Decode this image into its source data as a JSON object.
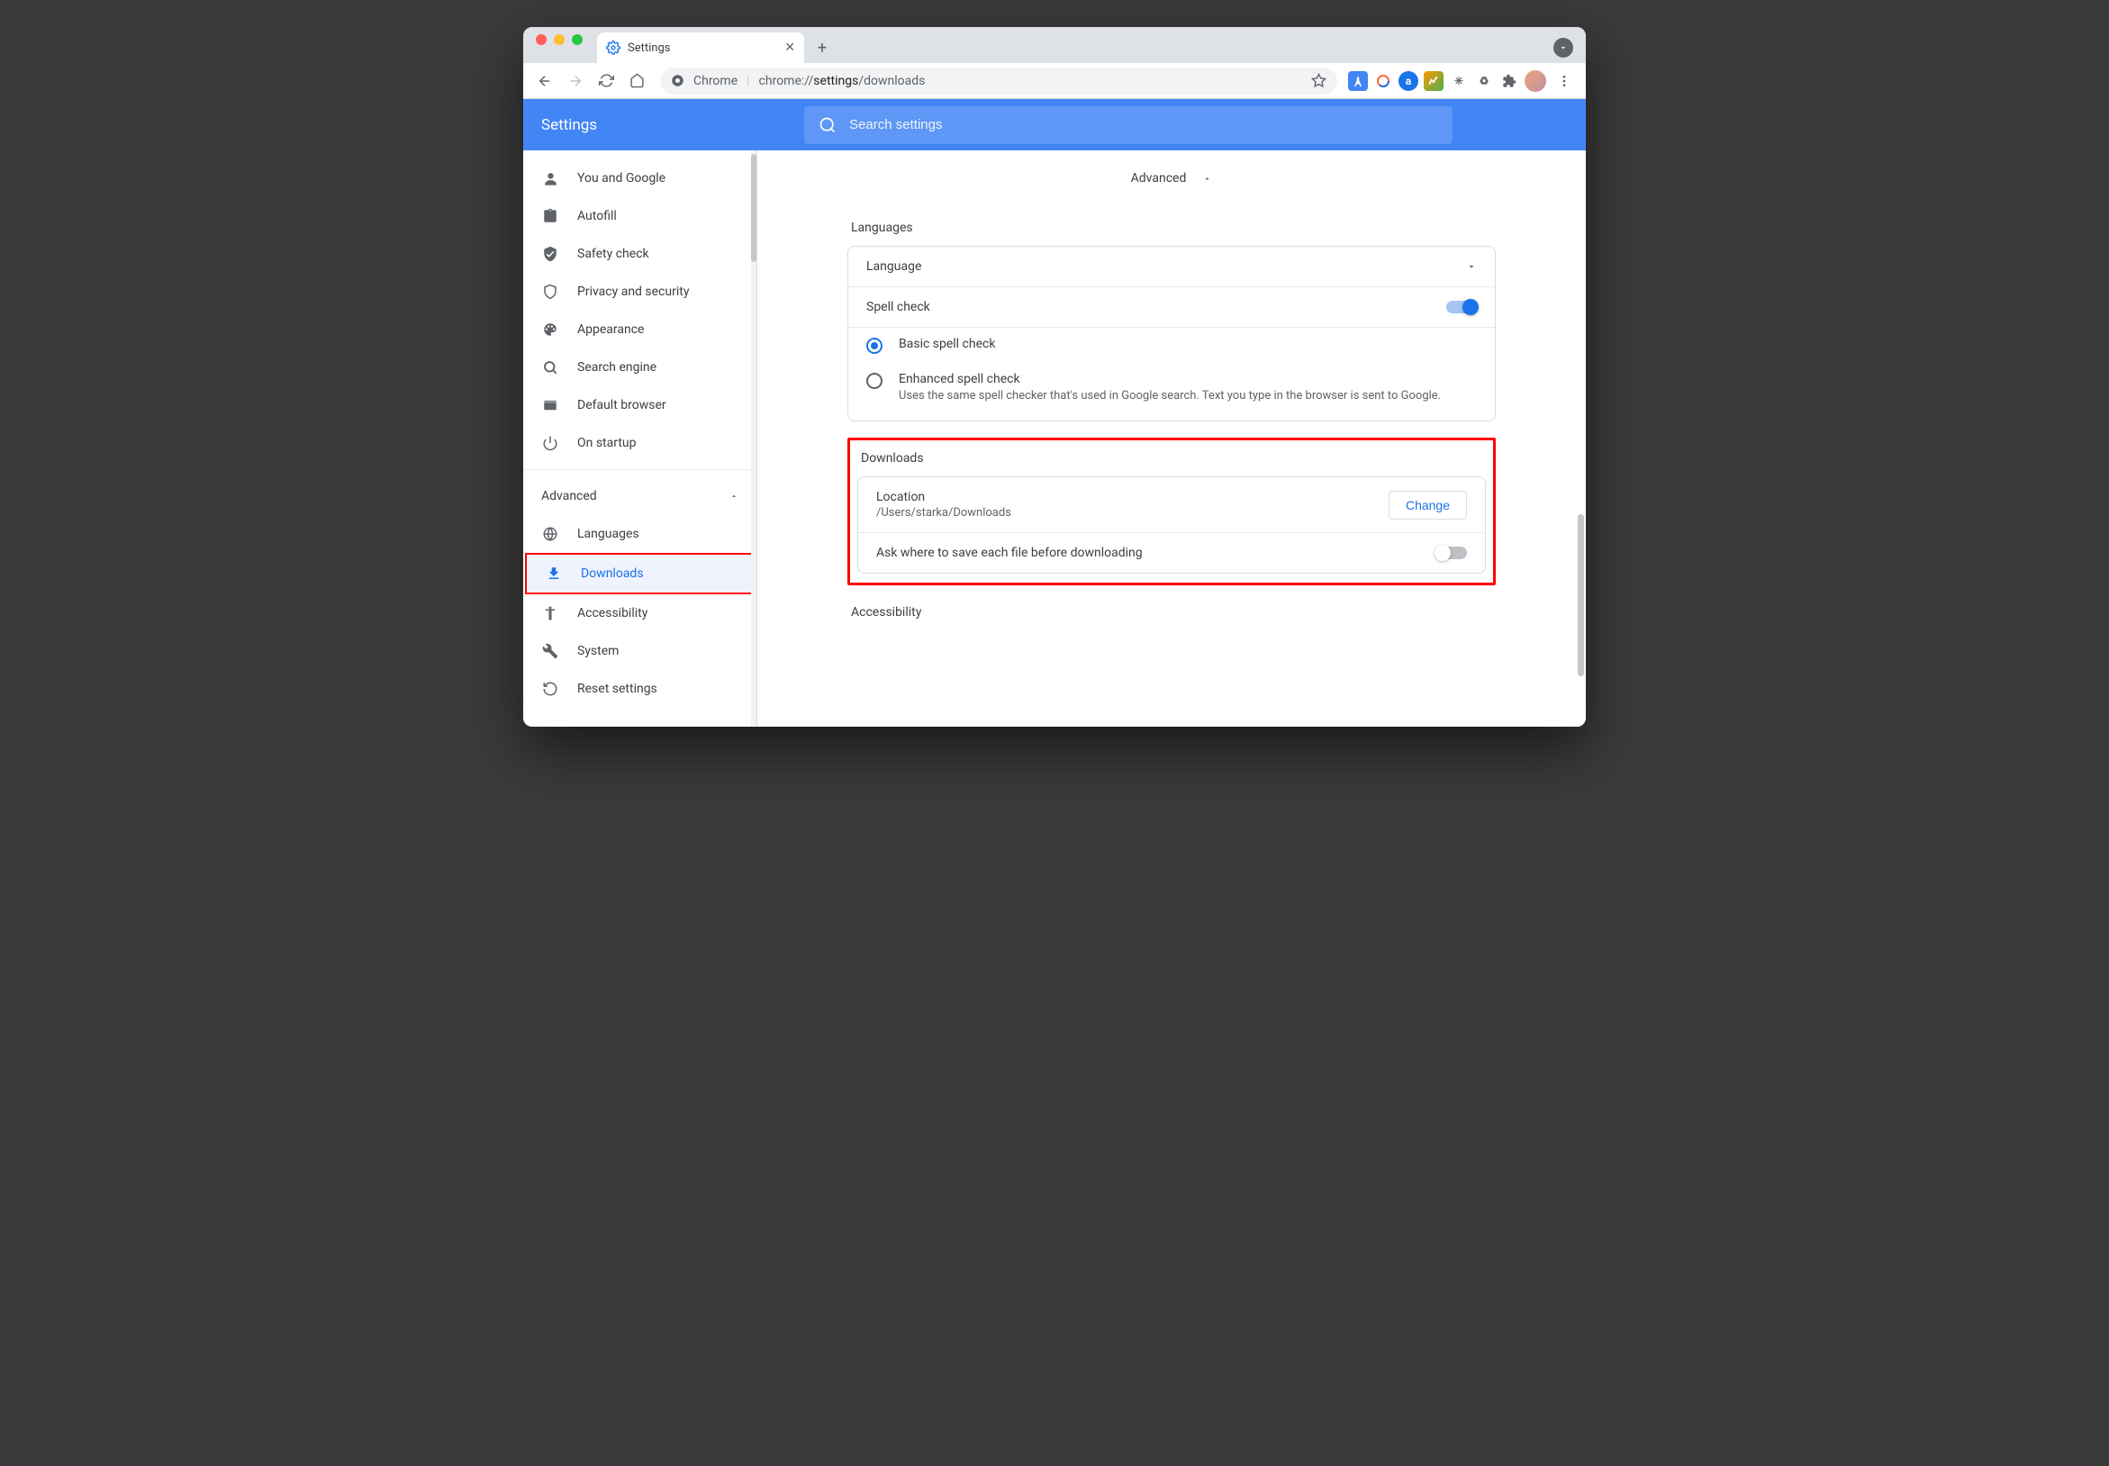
{
  "window": {
    "tab_title": "Settings",
    "omnibox_prefix": "Chrome",
    "omnibox_url_pre": "chrome://",
    "omnibox_url_strong": "settings",
    "omnibox_url_post": "/downloads"
  },
  "header": {
    "title": "Settings",
    "search_placeholder": "Search settings"
  },
  "sidebar": {
    "items": [
      {
        "label": "You and Google"
      },
      {
        "label": "Autofill"
      },
      {
        "label": "Safety check"
      },
      {
        "label": "Privacy and security"
      },
      {
        "label": "Appearance"
      },
      {
        "label": "Search engine"
      },
      {
        "label": "Default browser"
      },
      {
        "label": "On startup"
      }
    ],
    "advanced_label": "Advanced",
    "advanced_items": [
      {
        "label": "Languages"
      },
      {
        "label": "Downloads"
      },
      {
        "label": "Accessibility"
      },
      {
        "label": "System"
      },
      {
        "label": "Reset settings"
      }
    ]
  },
  "main": {
    "advanced_heading": "Advanced",
    "languages": {
      "title": "Languages",
      "language_row": "Language",
      "spellcheck_row": "Spell check",
      "basic": "Basic spell check",
      "enhanced": "Enhanced spell check",
      "enhanced_desc": "Uses the same spell checker that's used in Google search. Text you type in the browser is sent to Google."
    },
    "downloads": {
      "title": "Downloads",
      "location_label": "Location",
      "location_value": "/Users/starka/Downloads",
      "change_btn": "Change",
      "ask_label": "Ask where to save each file before downloading"
    },
    "accessibility_title": "Accessibility"
  }
}
